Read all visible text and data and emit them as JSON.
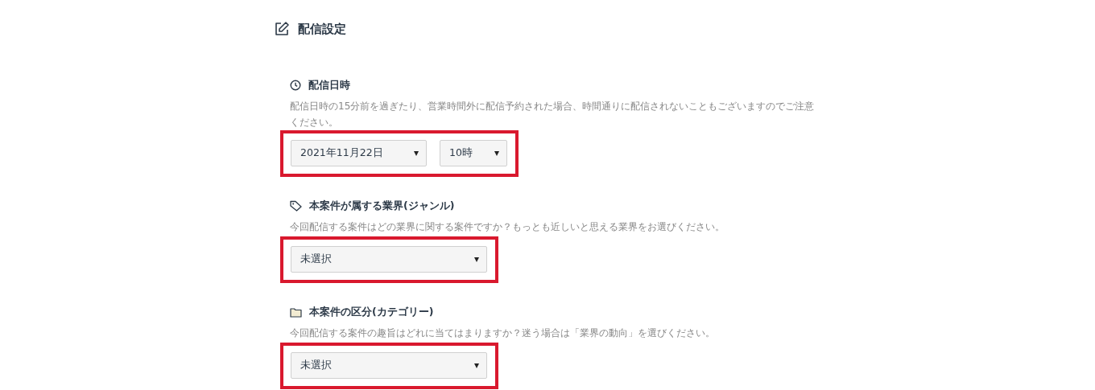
{
  "header": {
    "title": "配信設定"
  },
  "sections": [
    {
      "label": "配信日時",
      "description": "配信日時の15分前を過ぎたり、営業時間外に配信予約された場合、時間通りに配信されないこともございますのでご注意ください。",
      "highlighted": true,
      "selects": [
        {
          "value": "2021年11月22日"
        },
        {
          "value": "10時"
        }
      ]
    },
    {
      "label": "本案件が属する業界(ジャンル)",
      "description": "今回配信する案件はどの業界に関する案件ですか？もっとも近しいと思える業界をお選びください。",
      "highlighted": true,
      "selects": [
        {
          "value": "未選択"
        }
      ]
    },
    {
      "label": "本案件の区分(カテゴリー)",
      "description": "今回配信する案件の趣旨はどれに当てはまりますか？迷う場合は「業界の動向」を選びください。",
      "highlighted": true,
      "selects": [
        {
          "value": "未選択"
        }
      ]
    }
  ]
}
